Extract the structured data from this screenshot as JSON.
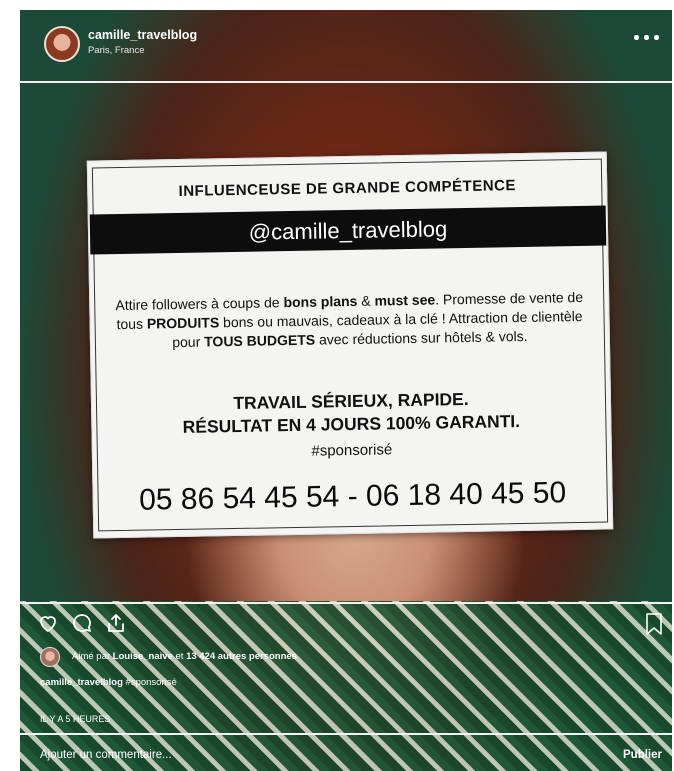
{
  "header": {
    "username": "camille_travelblog",
    "location": "Paris, France",
    "more_icon": "more-dots-icon"
  },
  "notice": {
    "heading": "INFLUENCEUSE DE GRANDE COMPÉTENCE",
    "handle": "@camille_travelblog",
    "description": {
      "p1": "Attire followers à coups de ",
      "b1": "bons plans",
      "p2": " & ",
      "b2": "must see",
      "p3": ". Promesse de vente de tous ",
      "b3": "PRODUITS",
      "p4": " bons ou mauvais, cadeaux à la clé ! Attraction de clientèle pour ",
      "b4": "TOUS BUDGETS",
      "p5": " avec réductions sur hôtels & vols."
    },
    "claim_line1": "TRAVAIL SÉRIEUX, RAPIDE.",
    "claim_line2": "RÉSULTAT EN 4 JOURS 100% GARANTI.",
    "hashtag": "#sponsorisé",
    "phones": "05 86 54 45 54 - 06 18 40 45 50"
  },
  "actions": {
    "like_icon": "heart-icon",
    "comment_icon": "comment-icon",
    "share_icon": "share-icon",
    "save_icon": "bookmark-icon"
  },
  "likes": {
    "prefix": "Aimé par ",
    "user": "Louise_naive",
    "middle": " et ",
    "count": "13 424 autres personnes"
  },
  "caption": {
    "user": "camille_travelblog",
    "text": " #sponsorisé"
  },
  "time": "IL Y A 5 HEURES",
  "comment": {
    "placeholder": "Ajouter un commentaire...",
    "publish": "Publier"
  },
  "colors": {
    "background": "#1d4a38",
    "overlay_text": "#ffffff",
    "notice_paper": "#f4f4f2",
    "notice_band": "#0d0d0d"
  }
}
